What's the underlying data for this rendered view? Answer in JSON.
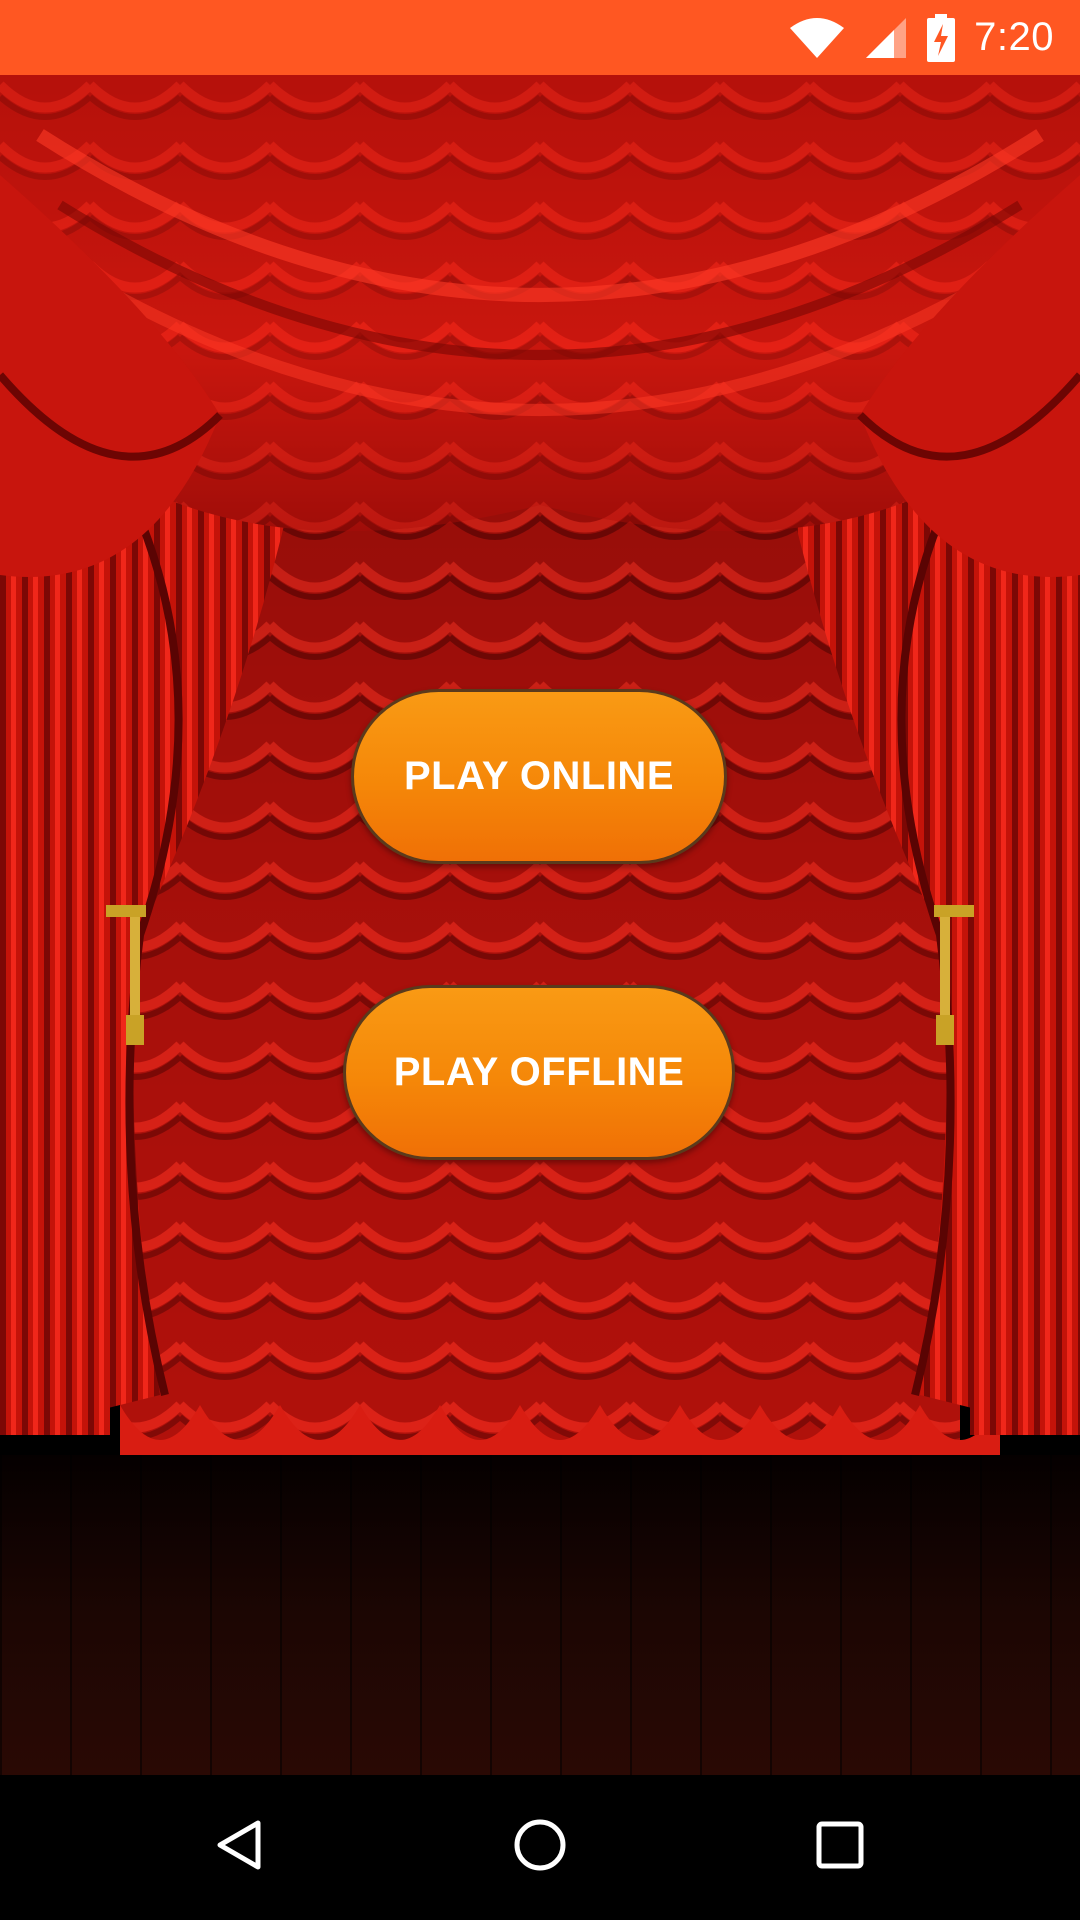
{
  "status_bar": {
    "time": "7:20",
    "background_color": "#ff5722",
    "icons": [
      "wifi-icon",
      "cell-signal-icon",
      "battery-charging-icon"
    ]
  },
  "stage": {
    "curtain_color": "#d81a12",
    "floor_color": "#1a0503"
  },
  "buttons": {
    "play_online": "PLAY ONLINE",
    "play_offline": "PLAY OFFLINE",
    "color": "#f58708"
  },
  "nav_bar": {
    "icons": [
      "back-icon",
      "home-icon",
      "recents-icon"
    ]
  }
}
